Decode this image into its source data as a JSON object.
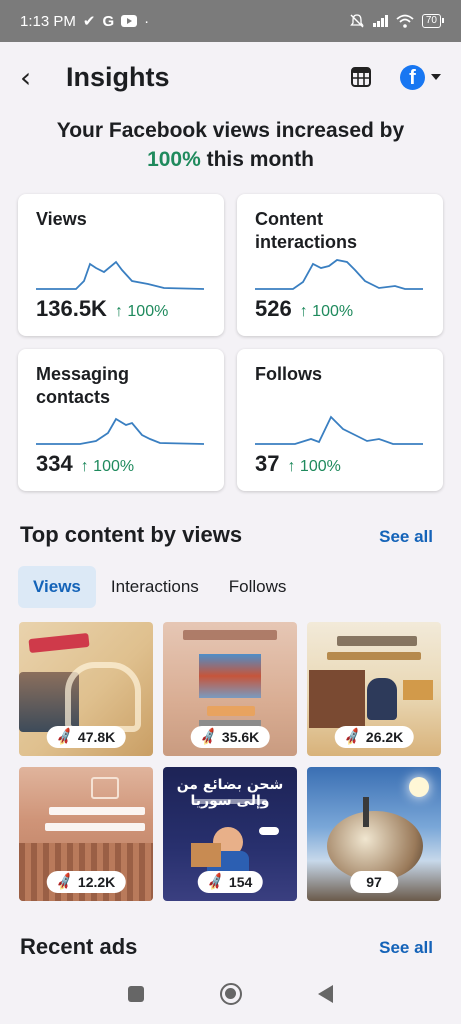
{
  "status_bar": {
    "time": "1:13 PM",
    "g_label": "G",
    "dot": "·",
    "battery": "70"
  },
  "app_bar": {
    "title": "Insights"
  },
  "headline": {
    "prefix": "Your Facebook views increased by",
    "percent": "100%",
    "suffix": " this month"
  },
  "cards": [
    {
      "label": "Views",
      "value": "136.5K",
      "change": "↑ 100%"
    },
    {
      "label": "Content interactions",
      "value": "526",
      "change": "↑ 100%"
    },
    {
      "label": "Messaging contacts",
      "value": "334",
      "change": "↑ 100%"
    },
    {
      "label": "Follows",
      "value": "37",
      "change": "↑ 100%"
    }
  ],
  "top_content": {
    "title": "Top content by views",
    "see_all": "See all",
    "tabs": [
      "Views",
      "Interactions",
      "Follows"
    ],
    "active_tab": "Views",
    "items": [
      {
        "views": "47.8K",
        "icon": "rocket-icon"
      },
      {
        "views": "35.6K",
        "icon": "rocket-icon"
      },
      {
        "views": "26.2K",
        "icon": "rocket-icon"
      },
      {
        "views": "12.2K",
        "icon": "rocket-icon"
      },
      {
        "views": "154",
        "icon": "rocket-icon"
      },
      {
        "views": "97",
        "icon": ""
      }
    ],
    "post_5_headline": "شحن بضائع من وإلى سوريا"
  },
  "recent_ads": {
    "title": "Recent ads",
    "see_all": "See all"
  },
  "colors": {
    "accent": "#1463b8",
    "positive": "#1f8a5d",
    "sparkline": "#3a7fc1",
    "facebook": "#1877f2"
  }
}
